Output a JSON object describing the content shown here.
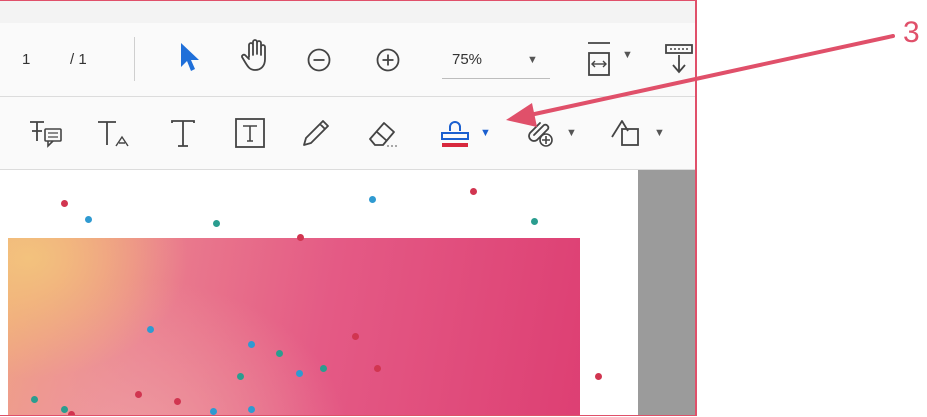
{
  "page_nav": {
    "current": "1",
    "total": "/ 1"
  },
  "zoom": {
    "value": "75%"
  },
  "callout": {
    "number": "3"
  },
  "colors": {
    "accent": "#e0506a",
    "stamp_icon": "#1a5fcf",
    "stamp_base": "#d8283d",
    "cursor": "#1f6fd9"
  },
  "icons": {
    "toolbar1": [
      "select-cursor-icon",
      "hand-icon",
      "zoom-out-icon",
      "zoom-in-icon",
      "fit-page-icon",
      "scroll-mode-icon"
    ],
    "toolbar2": [
      "add-comment-text-icon",
      "text-annotation-icon",
      "add-text-icon",
      "text-box-icon",
      "pencil-icon",
      "eraser-icon",
      "stamp-icon",
      "attach-file-icon",
      "shapes-icon"
    ]
  }
}
